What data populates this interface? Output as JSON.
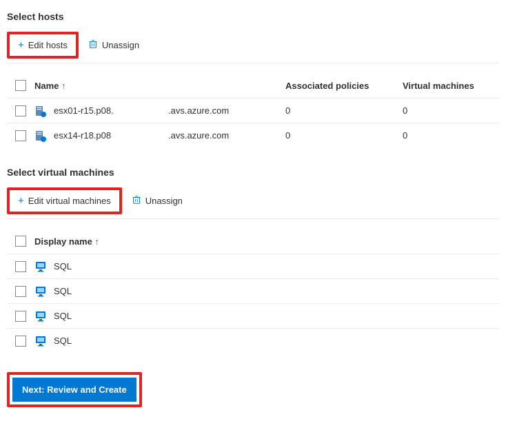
{
  "hosts": {
    "section_title": "Select hosts",
    "edit_label": "Edit hosts",
    "unassign_label": "Unassign",
    "columns": {
      "name": "Name",
      "policies": "Associated policies",
      "vms": "Virtual machines"
    },
    "rows": [
      {
        "name": "esx01-r15.p08.",
        "domain": ".avs.azure.com",
        "policies": "0",
        "vms": "0"
      },
      {
        "name": "esx14-r18.p08",
        "domain": ".avs.azure.com",
        "policies": "0",
        "vms": "0"
      }
    ]
  },
  "vms": {
    "section_title": "Select virtual machines",
    "edit_label": "Edit virtual machines",
    "unassign_label": "Unassign",
    "columns": {
      "display_name": "Display name"
    },
    "rows": [
      {
        "display_name": "SQL"
      },
      {
        "display_name": "SQL"
      },
      {
        "display_name": "SQL"
      },
      {
        "display_name": "SQL"
      }
    ]
  },
  "footer": {
    "next_label": "Next: Review and Create"
  }
}
